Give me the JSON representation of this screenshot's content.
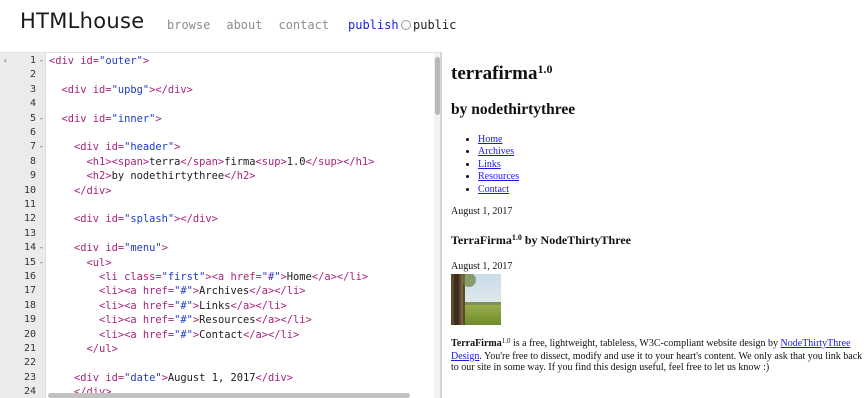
{
  "header": {
    "brand": "HTMLhouse",
    "nav": [
      "browse",
      "about",
      "contact"
    ],
    "publish_label": "publish",
    "public_label": "public"
  },
  "editor": {
    "lines": [
      {
        "n": "1",
        "fold": "-",
        "segments": [
          {
            "c": "tag",
            "t": "<div "
          },
          {
            "c": "attr",
            "t": "id="
          },
          {
            "c": "str",
            "t": "\"outer\""
          },
          {
            "c": "tag",
            "t": ">"
          }
        ]
      },
      {
        "n": "2",
        "fold": "",
        "segments": []
      },
      {
        "n": "3",
        "fold": "",
        "segments": [
          {
            "c": "txt",
            "t": "  "
          },
          {
            "c": "tag",
            "t": "<div "
          },
          {
            "c": "attr",
            "t": "id="
          },
          {
            "c": "str",
            "t": "\"upbg\""
          },
          {
            "c": "tag",
            "t": "></div>"
          }
        ]
      },
      {
        "n": "4",
        "fold": "",
        "segments": []
      },
      {
        "n": "5",
        "fold": "-",
        "segments": [
          {
            "c": "txt",
            "t": "  "
          },
          {
            "c": "tag",
            "t": "<div "
          },
          {
            "c": "attr",
            "t": "id="
          },
          {
            "c": "str",
            "t": "\"inner\""
          },
          {
            "c": "tag",
            "t": ">"
          }
        ]
      },
      {
        "n": "6",
        "fold": "",
        "segments": []
      },
      {
        "n": "7",
        "fold": "-",
        "segments": [
          {
            "c": "txt",
            "t": "    "
          },
          {
            "c": "tag",
            "t": "<div "
          },
          {
            "c": "attr",
            "t": "id="
          },
          {
            "c": "str",
            "t": "\"header\""
          },
          {
            "c": "tag",
            "t": ">"
          }
        ]
      },
      {
        "n": "8",
        "fold": "",
        "segments": [
          {
            "c": "txt",
            "t": "      "
          },
          {
            "c": "tag",
            "t": "<h1><span>"
          },
          {
            "c": "txt",
            "t": "terra"
          },
          {
            "c": "tag",
            "t": "</span>"
          },
          {
            "c": "txt",
            "t": "firma"
          },
          {
            "c": "tag",
            "t": "<sup>"
          },
          {
            "c": "txt",
            "t": "1.0"
          },
          {
            "c": "tag",
            "t": "</sup></h1>"
          }
        ]
      },
      {
        "n": "9",
        "fold": "",
        "segments": [
          {
            "c": "txt",
            "t": "      "
          },
          {
            "c": "tag",
            "t": "<h2>"
          },
          {
            "c": "txt",
            "t": "by nodethirtythree"
          },
          {
            "c": "tag",
            "t": "</h2>"
          }
        ]
      },
      {
        "n": "10",
        "fold": "",
        "segments": [
          {
            "c": "txt",
            "t": "    "
          },
          {
            "c": "tag",
            "t": "</div>"
          }
        ]
      },
      {
        "n": "11",
        "fold": "",
        "segments": []
      },
      {
        "n": "12",
        "fold": "",
        "segments": [
          {
            "c": "txt",
            "t": "    "
          },
          {
            "c": "tag",
            "t": "<div "
          },
          {
            "c": "attr",
            "t": "id="
          },
          {
            "c": "str",
            "t": "\"splash\""
          },
          {
            "c": "tag",
            "t": "></div>"
          }
        ]
      },
      {
        "n": "13",
        "fold": "",
        "segments": []
      },
      {
        "n": "14",
        "fold": "-",
        "segments": [
          {
            "c": "txt",
            "t": "    "
          },
          {
            "c": "tag",
            "t": "<div "
          },
          {
            "c": "attr",
            "t": "id="
          },
          {
            "c": "str",
            "t": "\"menu\""
          },
          {
            "c": "tag",
            "t": ">"
          }
        ]
      },
      {
        "n": "15",
        "fold": "-",
        "segments": [
          {
            "c": "txt",
            "t": "      "
          },
          {
            "c": "tag",
            "t": "<ul>"
          }
        ]
      },
      {
        "n": "16",
        "fold": "",
        "segments": [
          {
            "c": "txt",
            "t": "        "
          },
          {
            "c": "tag",
            "t": "<li "
          },
          {
            "c": "attr",
            "t": "class="
          },
          {
            "c": "str",
            "t": "\"first\""
          },
          {
            "c": "tag",
            "t": "><a "
          },
          {
            "c": "attr",
            "t": "href="
          },
          {
            "c": "str",
            "t": "\"#\""
          },
          {
            "c": "tag",
            "t": ">"
          },
          {
            "c": "txt",
            "t": "Home"
          },
          {
            "c": "tag",
            "t": "</a></li>"
          }
        ]
      },
      {
        "n": "17",
        "fold": "",
        "segments": [
          {
            "c": "txt",
            "t": "        "
          },
          {
            "c": "tag",
            "t": "<li><a "
          },
          {
            "c": "attr",
            "t": "href="
          },
          {
            "c": "str",
            "t": "\"#\""
          },
          {
            "c": "tag",
            "t": ">"
          },
          {
            "c": "txt",
            "t": "Archives"
          },
          {
            "c": "tag",
            "t": "</a></li>"
          }
        ]
      },
      {
        "n": "18",
        "fold": "",
        "segments": [
          {
            "c": "txt",
            "t": "        "
          },
          {
            "c": "tag",
            "t": "<li><a "
          },
          {
            "c": "attr",
            "t": "href="
          },
          {
            "c": "str",
            "t": "\"#\""
          },
          {
            "c": "tag",
            "t": ">"
          },
          {
            "c": "txt",
            "t": "Links"
          },
          {
            "c": "tag",
            "t": "</a></li>"
          }
        ]
      },
      {
        "n": "19",
        "fold": "",
        "segments": [
          {
            "c": "txt",
            "t": "        "
          },
          {
            "c": "tag",
            "t": "<li><a "
          },
          {
            "c": "attr",
            "t": "href="
          },
          {
            "c": "str",
            "t": "\"#\""
          },
          {
            "c": "tag",
            "t": ">"
          },
          {
            "c": "txt",
            "t": "Resources"
          },
          {
            "c": "tag",
            "t": "</a></li>"
          }
        ]
      },
      {
        "n": "20",
        "fold": "",
        "segments": [
          {
            "c": "txt",
            "t": "        "
          },
          {
            "c": "tag",
            "t": "<li><a "
          },
          {
            "c": "attr",
            "t": "href="
          },
          {
            "c": "str",
            "t": "\"#\""
          },
          {
            "c": "tag",
            "t": ">"
          },
          {
            "c": "txt",
            "t": "Contact"
          },
          {
            "c": "tag",
            "t": "</a></li>"
          }
        ]
      },
      {
        "n": "21",
        "fold": "",
        "segments": [
          {
            "c": "txt",
            "t": "      "
          },
          {
            "c": "tag",
            "t": "</ul>"
          }
        ]
      },
      {
        "n": "22",
        "fold": "",
        "segments": []
      },
      {
        "n": "23",
        "fold": "",
        "segments": [
          {
            "c": "txt",
            "t": "    "
          },
          {
            "c": "tag",
            "t": "<div "
          },
          {
            "c": "attr",
            "t": "id="
          },
          {
            "c": "str",
            "t": "\"date\""
          },
          {
            "c": "tag",
            "t": ">"
          },
          {
            "c": "txt",
            "t": "August 1, 2017"
          },
          {
            "c": "tag",
            "t": "</div>"
          }
        ]
      },
      {
        "n": "24",
        "fold": "",
        "segments": [
          {
            "c": "txt",
            "t": "    "
          },
          {
            "c": "tag",
            "t": "</div>"
          }
        ]
      }
    ]
  },
  "preview": {
    "h1_text": "terrafirma",
    "h1_sup": "1.0",
    "h2": "by nodethirtythree",
    "menu": [
      "Home",
      "Archives",
      "Links",
      "Resources",
      "Contact"
    ],
    "date1": "August 1, 2017",
    "h3_a": "TerraFirma",
    "h3_sup": "1.0",
    "h3_b": " by NodeThirtyThree",
    "date2": "August 1, 2017",
    "para_bold": "TerraFirma",
    "para_sup": "1.0",
    "para_1": " is a free, lightweight, tableless, W3C-compliant website design by ",
    "para_link": "NodeThirtyThree Design",
    "para_2": ". You're free to dissect, modify and use it to your heart's content. We only ask that you link back to our site in some way. If you find this design useful, feel free to let us know :)"
  },
  "colors": {
    "tag": "#a6237b",
    "string": "#1f3cc2",
    "link": "#1a1ae6",
    "publish": "#1d1de0",
    "nav": "#8d8d8d",
    "gutter": "#ebebeb"
  },
  "icons": {
    "gutter_collapse": "collapse-arrow-icon"
  }
}
